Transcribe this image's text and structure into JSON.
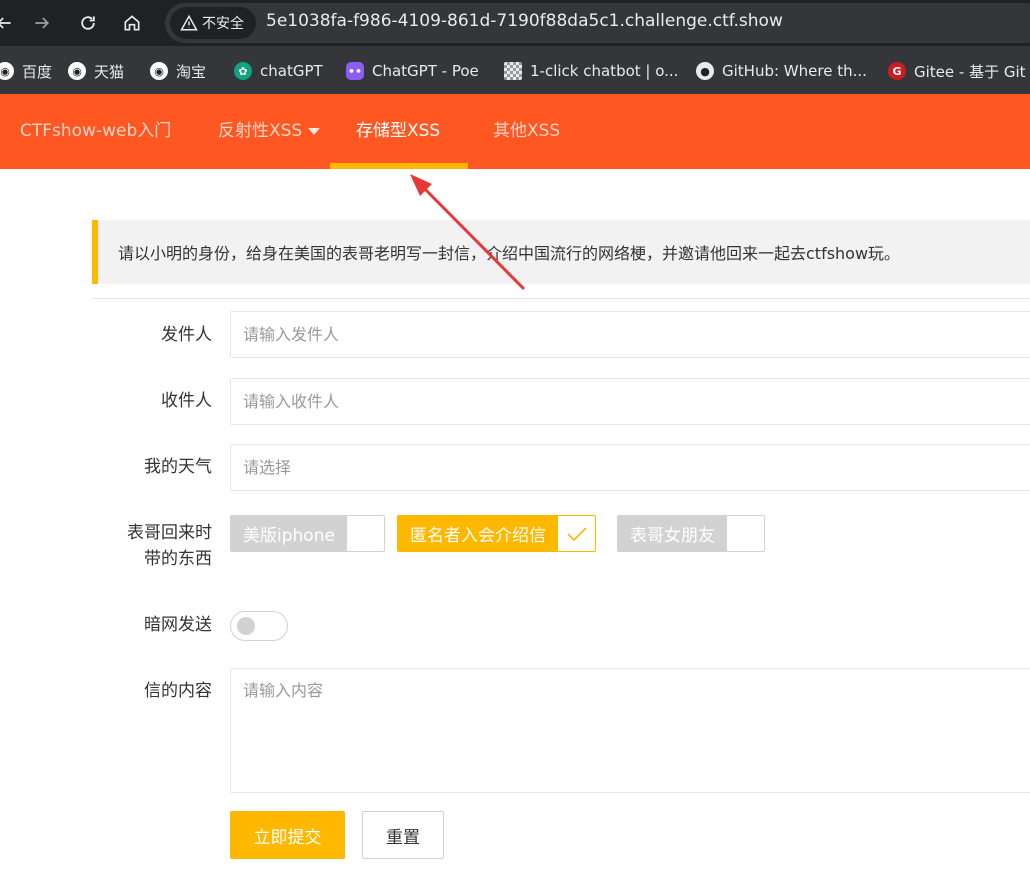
{
  "browser": {
    "security_label": "不安全",
    "url": "5e1038fa-f986-4109-861d-7190f88da5c1.challenge.ctf.show",
    "bookmarks": [
      {
        "label": "百度",
        "icon": "globe-icon"
      },
      {
        "label": "天猫",
        "icon": "globe-icon"
      },
      {
        "label": "淘宝",
        "icon": "globe-icon"
      },
      {
        "label": "chatGPT",
        "icon": "openai-icon"
      },
      {
        "label": "ChatGPT - Poe",
        "icon": "poe-icon"
      },
      {
        "label": "1-click chatbot | o...",
        "icon": "checker-icon"
      },
      {
        "label": "GitHub: Where th...",
        "icon": "github-icon"
      },
      {
        "label": "Gitee - 基于 Git",
        "icon": "gitee-icon"
      }
    ]
  },
  "nav": {
    "brand": "CTFshow-web入门",
    "items": [
      {
        "label": "反射性XSS",
        "has_dropdown": true
      },
      {
        "label": "存储型XSS",
        "active": true
      },
      {
        "label": "其他XSS"
      }
    ]
  },
  "notice": "请以小明的身份，给身在美国的表哥老明写一封信，介绍中国流行的网络梗，并邀请他回来一起去ctfshow玩。",
  "form": {
    "sender": {
      "label": "发件人",
      "placeholder": "请输入发件人"
    },
    "recipient": {
      "label": "收件人",
      "placeholder": "请输入收件人"
    },
    "weather": {
      "label": "我的天气",
      "placeholder": "请选择"
    },
    "gifts": {
      "label_line1": "表哥回来时",
      "label_line2": "带的东西",
      "options": [
        {
          "label": "美版iphone",
          "checked": false
        },
        {
          "label": "匿名者入会介绍信",
          "checked": true
        },
        {
          "label": "表哥女朋友",
          "checked": false
        }
      ]
    },
    "darknet": {
      "label": "暗网发送",
      "on": false
    },
    "content": {
      "label": "信的内容",
      "placeholder": "请输入内容"
    },
    "submit_label": "立即提交",
    "reset_label": "重置"
  },
  "colors": {
    "nav_bg": "#ff5722",
    "accent": "#ffb800",
    "annotation_arrow": "#e53935"
  }
}
